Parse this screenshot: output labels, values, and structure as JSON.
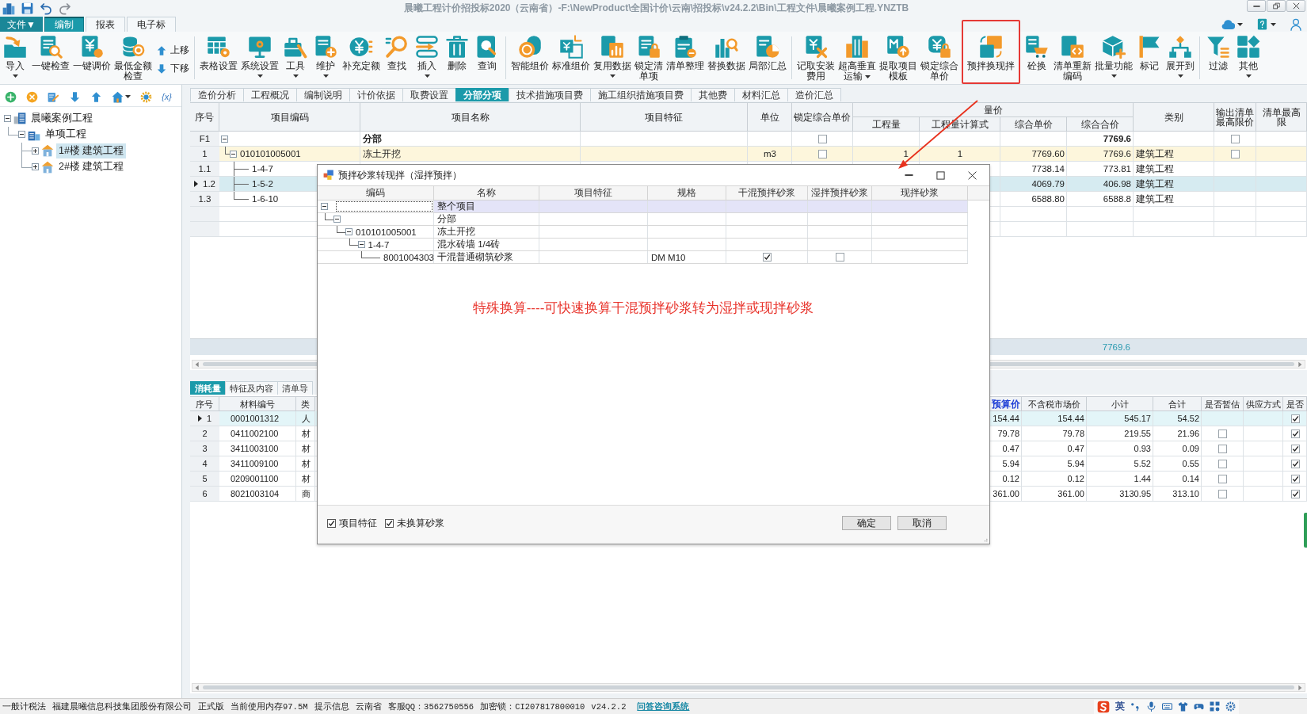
{
  "title_bar": {
    "title": "晨曦工程计价招投标2020（云南省）-F:\\NewProduct\\全国计价\\云南\\招投标\\v24.2.2\\Bin\\工程文件\\晨曦案例工程.YNZTB"
  },
  "menu_tabs": [
    {
      "label": "文件▼",
      "kind": "file",
      "selected": false
    },
    {
      "label": "编制",
      "kind": "tab",
      "selected": true
    },
    {
      "label": "报表",
      "kind": "tab",
      "selected": false
    },
    {
      "label": "电子标",
      "kind": "tab",
      "selected": false
    }
  ],
  "ribbon": {
    "groups": [
      {
        "items": [
          {
            "kind": "large",
            "lines": [
              "导入"
            ],
            "dropdown": true,
            "highlighted": false
          },
          {
            "kind": "large",
            "lines": [
              "一键检查"
            ],
            "dropdown": false,
            "highlighted": false
          },
          {
            "kind": "large",
            "lines": [
              "一键调价"
            ],
            "dropdown": false,
            "highlighted": false
          },
          {
            "kind": "large",
            "lines": [
              "最低金额",
              "检查"
            ],
            "dropdown": false,
            "highlighted": false
          },
          {
            "kind": "stack",
            "buttons": [
              "上移",
              "下移"
            ]
          }
        ]
      },
      {
        "items": [
          {
            "kind": "large",
            "lines": [
              "表格设置"
            ],
            "dropdown": false,
            "highlighted": false
          },
          {
            "kind": "large",
            "lines": [
              "系统设置"
            ],
            "dropdown": true,
            "highlighted": false
          },
          {
            "kind": "large",
            "lines": [
              "工具"
            ],
            "dropdown": true,
            "highlighted": false
          },
          {
            "kind": "large",
            "lines": [
              "维护"
            ],
            "dropdown": true,
            "highlighted": false
          },
          {
            "kind": "large",
            "lines": [
              "补充定额"
            ],
            "dropdown": false,
            "highlighted": false
          },
          {
            "kind": "large",
            "lines": [
              "查找"
            ],
            "dropdown": false,
            "highlighted": false
          },
          {
            "kind": "large",
            "lines": [
              "插入"
            ],
            "dropdown": true,
            "highlighted": false
          },
          {
            "kind": "large",
            "lines": [
              "删除"
            ],
            "dropdown": false,
            "highlighted": false
          },
          {
            "kind": "large",
            "lines": [
              "查询"
            ],
            "dropdown": false,
            "highlighted": false
          }
        ]
      },
      {
        "items": [
          {
            "kind": "large",
            "lines": [
              "智能组价"
            ],
            "dropdown": false,
            "highlighted": false
          },
          {
            "kind": "large",
            "lines": [
              "标准组价"
            ],
            "dropdown": false,
            "highlighted": false
          },
          {
            "kind": "large",
            "lines": [
              "复用数据"
            ],
            "dropdown": true,
            "highlighted": false
          },
          {
            "kind": "large",
            "lines": [
              "锁定清",
              "单项"
            ],
            "dropdown": false,
            "highlighted": false
          },
          {
            "kind": "large",
            "lines": [
              "清单整理"
            ],
            "dropdown": false,
            "highlighted": false
          },
          {
            "kind": "large",
            "lines": [
              "替换数据"
            ],
            "dropdown": false,
            "highlighted": false
          },
          {
            "kind": "large",
            "lines": [
              "局部汇总"
            ],
            "dropdown": false,
            "highlighted": false
          }
        ]
      },
      {
        "items": [
          {
            "kind": "large",
            "lines": [
              "记取安装",
              "费用"
            ],
            "dropdown": false,
            "highlighted": false
          },
          {
            "kind": "large",
            "lines": [
              "超高垂直",
              "运输"
            ],
            "dropdown": true,
            "highlighted": false
          },
          {
            "kind": "large",
            "lines": [
              "提取项目",
              "模板"
            ],
            "dropdown": false,
            "highlighted": false
          },
          {
            "kind": "large",
            "lines": [
              "锁定综合",
              "单价"
            ],
            "dropdown": false,
            "highlighted": false
          },
          {
            "kind": "large",
            "lines": [
              "预拌换现拌"
            ],
            "dropdown": false,
            "highlighted": true
          },
          {
            "kind": "large",
            "lines": [
              "砼换"
            ],
            "dropdown": false,
            "highlighted": false
          },
          {
            "kind": "large",
            "lines": [
              "清单重新",
              "编码"
            ],
            "dropdown": false,
            "highlighted": false
          },
          {
            "kind": "large",
            "lines": [
              "批量功能"
            ],
            "dropdown": true,
            "highlighted": false
          },
          {
            "kind": "large",
            "lines": [
              "标记"
            ],
            "dropdown": false,
            "highlighted": false
          },
          {
            "kind": "large",
            "lines": [
              "展开到"
            ],
            "dropdown": true,
            "highlighted": false
          }
        ]
      },
      {
        "items": [
          {
            "kind": "large",
            "lines": [
              "过滤"
            ],
            "dropdown": false,
            "highlighted": false
          },
          {
            "kind": "large",
            "lines": [
              "其他"
            ],
            "dropdown": true,
            "highlighted": false
          }
        ]
      }
    ]
  },
  "left_panel": {
    "toolbar_text": "{x}",
    "tree": [
      {
        "label": "晨曦案例工程",
        "kind": "project",
        "expanded": true,
        "selected": false,
        "children": [
          {
            "label": "单项工程",
            "kind": "single",
            "expanded": true,
            "selected": false,
            "children": [
              {
                "label": "1#楼 建筑工程",
                "kind": "unit",
                "expanded": false,
                "selected": true
              },
              {
                "label": "2#楼 建筑工程",
                "kind": "unit",
                "expanded": false,
                "selected": false
              }
            ]
          }
        ]
      }
    ]
  },
  "main_tabs": [
    {
      "label": "造价分析",
      "selected": false
    },
    {
      "label": "工程概况",
      "selected": false
    },
    {
      "label": "编制说明",
      "selected": false
    },
    {
      "label": "计价依据",
      "selected": false
    },
    {
      "label": "取费设置",
      "selected": false
    },
    {
      "label": "分部分项",
      "selected": true
    },
    {
      "label": "技术措施项目费",
      "selected": false
    },
    {
      "label": "施工组织措施项目费",
      "selected": false
    },
    {
      "label": "其他费",
      "selected": false
    },
    {
      "label": "材料汇总",
      "selected": false
    },
    {
      "label": "造价汇总",
      "selected": false
    }
  ],
  "bill_table": {
    "columns": [
      {
        "label": "序号"
      },
      {
        "label": "项目编码"
      },
      {
        "label": "项目名称"
      },
      {
        "label": "项目特征"
      },
      {
        "label": "单位"
      },
      {
        "label": "锁定综合单价"
      },
      {
        "label": "量价",
        "children": [
          {
            "label": "工程量"
          },
          {
            "label": "工程量计算式"
          },
          {
            "label": "综合单价"
          },
          {
            "label": "综合合价"
          }
        ]
      },
      {
        "label": "类别"
      },
      {
        "label": "输出清单最高限价"
      },
      {
        "label": "清单最高限"
      }
    ],
    "rows": [
      {
        "seq": "F1",
        "kind": "division",
        "selected": false,
        "expanded": true,
        "name": "分部",
        "locked": false,
        "total_price": "7769.6",
        "output_limit": false,
        "children": [
          {
            "seq": "1",
            "kind": "bill",
            "selected": false,
            "expanded": true,
            "code": "010101005001",
            "name": "冻土开挖",
            "unit": "m3",
            "locked": false,
            "quantity": "1",
            "formula": "1",
            "unit_price": "7769.60",
            "total_price": "7769.6",
            "category": "建筑工程",
            "output_limit": false,
            "children": [
              {
                "seq": "1.1",
                "kind": "quota",
                "selected": false,
                "code": "1-4-7",
                "unit_price": "7738.14",
                "total_price": "773.81",
                "category": "建筑工程"
              },
              {
                "seq": "1.2",
                "kind": "quota",
                "selected": true,
                "code": "1-5-2",
                "unit_price": "4069.79",
                "total_price": "406.98",
                "category": "建筑工程"
              },
              {
                "seq": "1.3",
                "kind": "quota",
                "selected": false,
                "code": "1-6-10",
                "unit_price": "6588.80",
                "total_price": "6588.8",
                "category": "建筑工程"
              }
            ]
          }
        ]
      }
    ],
    "total": "7769.6"
  },
  "material_tabs": [
    {
      "label": "消耗量",
      "selected": true
    },
    {
      "label": "特征及内容",
      "selected": false
    },
    {
      "label": "清单导",
      "selected": false
    }
  ],
  "material_table": {
    "columns": [
      {
        "label": "序号"
      },
      {
        "label": "材料编号"
      },
      {
        "label": "类"
      },
      {
        "label": "预算价",
        "color": "#1f3fd6"
      },
      {
        "label": "不含税市场价"
      },
      {
        "label": "小计"
      },
      {
        "label": "合计"
      },
      {
        "label": "是否暂估"
      },
      {
        "label": "供应方式"
      },
      {
        "label": "是否"
      }
    ],
    "rows": [
      {
        "seq": "1",
        "selected": true,
        "code": "0001001312",
        "type": "人",
        "budget_price": "154.44",
        "market_price": "154.44",
        "subtotal": "545.17",
        "total": "54.52",
        "column_10": true
      },
      {
        "seq": "2",
        "selected": false,
        "code": "0411002100",
        "type": "材",
        "budget_price": "79.78",
        "market_price": "79.78",
        "subtotal": "219.55",
        "total": "21.96",
        "provisional": false,
        "column_10": true
      },
      {
        "seq": "3",
        "selected": false,
        "code": "3411003100",
        "type": "材",
        "budget_price": "0.47",
        "market_price": "0.47",
        "subtotal": "0.93",
        "total": "0.09",
        "provisional": false,
        "column_10": true
      },
      {
        "seq": "4",
        "selected": false,
        "code": "3411009100",
        "type": "材",
        "budget_price": "5.94",
        "market_price": "5.94",
        "subtotal": "5.52",
        "total": "0.55",
        "provisional": false,
        "column_10": true
      },
      {
        "seq": "5",
        "selected": false,
        "code": "0209001100",
        "type": "材",
        "budget_price": "0.12",
        "market_price": "0.12",
        "subtotal": "1.44",
        "total": "0.14",
        "provisional": false,
        "column_10": true
      },
      {
        "seq": "6",
        "selected": false,
        "code": "8021003104",
        "type": "商",
        "budget_price": "361.00",
        "market_price": "361.00",
        "subtotal": "3130.95",
        "total": "313.10",
        "provisional": false,
        "column_10": true
      }
    ]
  },
  "dialog": {
    "title": "预拌砂浆转现拌（湿拌预拌）",
    "columns": [
      "编码",
      "名称",
      "项目特征",
      "规格",
      "干混预拌砂浆",
      "湿拌预拌砂浆",
      "现拌砂浆"
    ],
    "rows": [
      {
        "name": "整个项目",
        "expanded": true,
        "selected": true,
        "children": [
          {
            "name": "分部",
            "expanded": true,
            "selected": false,
            "children": [
              {
                "code": "010101005001",
                "name": "冻土开挖",
                "expanded": true,
                "selected": false,
                "children": [
                  {
                    "code": "1-4-7",
                    "name": "混水砖墙 1/4砖",
                    "expanded": true,
                    "selected": false,
                    "children": [
                      {
                        "code": "8001004303",
                        "name": "干混普通砌筑砂浆",
                        "spec": "DM M10",
                        "dry_mix": true,
                        "wet_mix": false,
                        "selected": false
                      }
                    ]
                  }
                ]
              }
            ]
          }
        ]
      }
    ],
    "note": "特殊换算----可快速换算干混预拌砂浆转为湿拌或现拌砂浆",
    "options": [
      {
        "label": "项目特征",
        "checked": true
      },
      {
        "label": "未换算砂浆",
        "checked": true
      }
    ],
    "buttons": [
      "确定",
      "取消"
    ]
  },
  "status_bar": {
    "items": [
      "一般计税法",
      "福建晨曦信息科技集团股份有限公司",
      "正式版",
      "当前使用内存97.5M",
      "提示信息",
      "云南省",
      "客服QQ：3562750556",
      "加密锁：CI207817800010",
      "v24.2.2"
    ],
    "link": "问答咨询系统",
    "ime_mode": "英"
  }
}
